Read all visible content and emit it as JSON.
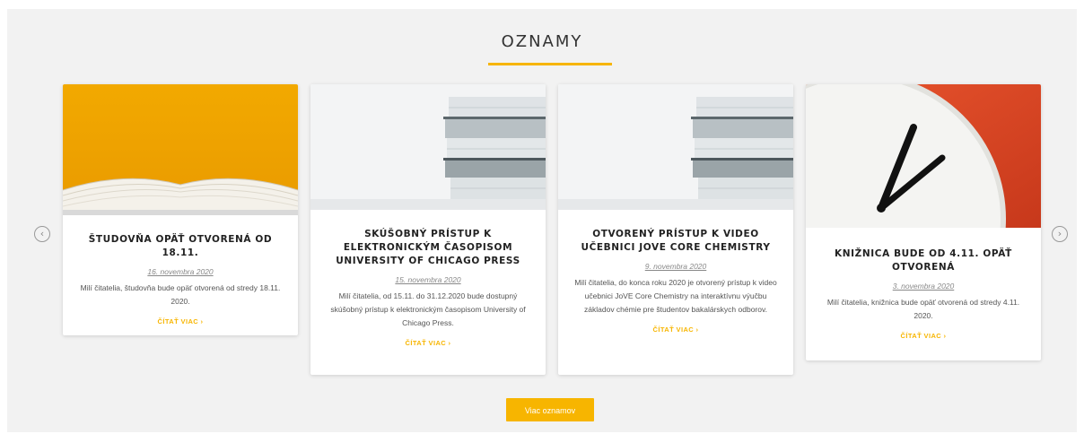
{
  "section": {
    "title": "OZNAMY"
  },
  "colors": {
    "accent": "#f7b500",
    "panel": "#f2f2f2"
  },
  "nav": {
    "prev_icon": "‹",
    "next_icon": "›"
  },
  "cards": [
    {
      "title": "ŠTUDOVŇA OPÄŤ OTVORENÁ OD 18.11.",
      "date": "16. novembra 2020",
      "excerpt": "Milí čitatelia, študovňa bude opäť otvorená od stredy 18.11. 2020.",
      "more": "ČÍTAŤ VIAC ›",
      "image": "open-book-on-yellow"
    },
    {
      "title": "SKÚŠOBNÝ PRÍSTUP K ELEKTRONICKÝM ČASOPISOM UNIVERSITY OF CHICAGO PRESS",
      "date": "15. novembra 2020",
      "excerpt": "Milí čitatelia, od 15.11. do 31.12.2020 bude dostupný skúšobný prístup k elektronickým časopisom University of Chicago Press.",
      "more": "ČÍTAŤ VIAC ›",
      "image": "stacked-books"
    },
    {
      "title": "OTVORENÝ PRÍSTUP K VIDEO UČEBNICI JOVE CORE CHEMISTRY",
      "date": "9. novembra 2020",
      "excerpt": "Milí čitatelia, do konca roku 2020 je otvorený prístup k video učebnici JoVE Core Chemistry na interaktívnu výučbu základov chémie pre študentov bakalárskych odborov.",
      "more": "ČÍTAŤ VIAC ›",
      "image": "stacked-books"
    },
    {
      "title": "KNIŽNICA BUDE OD 4.11. OPÄŤ OTVORENÁ",
      "date": "3. novembra 2020",
      "excerpt": "Milí čitatelia, knižnica bude opäť otvorená od stredy 4.11. 2020.",
      "more": "ČÍTAŤ VIAC ›",
      "image": "clock-on-orange"
    }
  ],
  "footer": {
    "more_button": "Viac oznamov"
  }
}
